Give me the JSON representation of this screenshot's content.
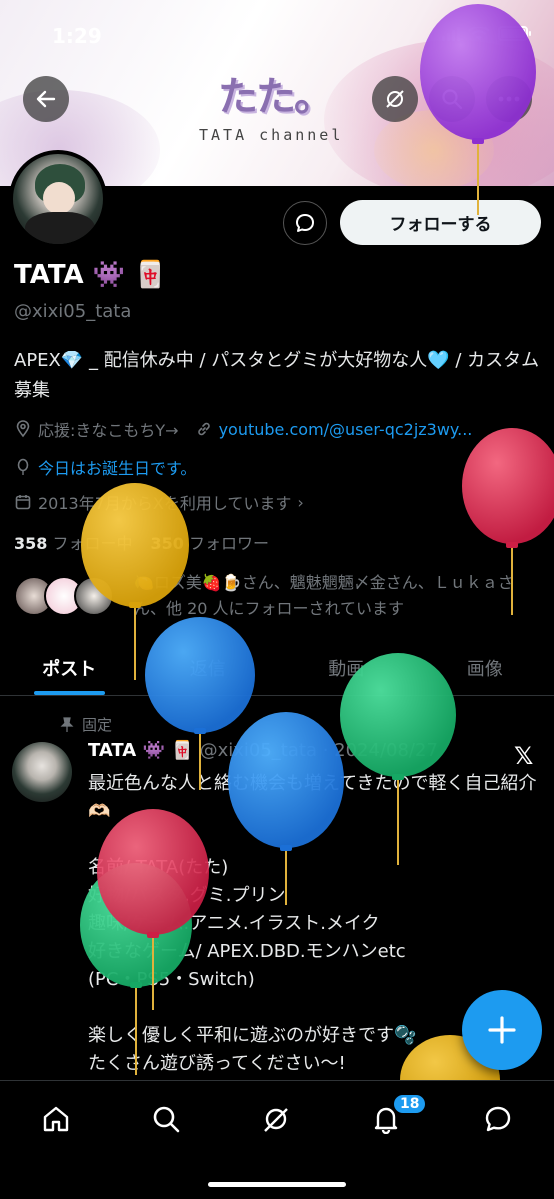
{
  "status_bar": {
    "time": "1:29"
  },
  "banner": {
    "logo_text": "たた。",
    "subtitle": "TATA channel"
  },
  "header": {
    "back_icon": "arrow-left-icon",
    "grok_icon": "grok-icon",
    "search_icon": "search-icon",
    "more_icon": "more-icon"
  },
  "profile": {
    "display_name": "TATA 👾 🀄",
    "handle": "@xixi05_tata",
    "bio": "APEX💎 _ 配信休み中 / パスタとグミが大好物な人🩵 / カスタム募集",
    "support": "応援:きなこもちY→",
    "link": "youtube.com/@user-qc2jz3wy...",
    "birthday": "今日はお誕生日です。",
    "joined": "2013年7月からXを利用しています",
    "following_count": "358",
    "following_label": "フォロー中",
    "followers_count": "350",
    "followers_label": "フォロワー",
    "followed_by": "🍋ロズ美🍓🍺さん、魑魅魍魎〆金さん、Ｌｕｋａさん、他 20 人にフォローされています"
  },
  "actions": {
    "follow_label": "フォローする"
  },
  "tabs": [
    {
      "label": "ポスト"
    },
    {
      "label": "返信"
    },
    {
      "label": "動画"
    },
    {
      "label": "画像"
    }
  ],
  "post": {
    "pinned_label": "固定",
    "name": "TATA 👾 🀄",
    "handle_date": "@xixi05_tata · 2024/08/27",
    "lines": [
      "最近色んな人と絡む機会も増えてきたので軽く自己紹介🫶🏻",
      "",
      "名前/ TATA(たた)",
      "好物/パスタ.グミ.プリン",
      "趣味/ゲーム.アニメ.イラスト.メイク",
      "好きなゲーム/ APEX.DBD.モンハンetc",
      "(PC・PS5・Switch)",
      "",
      "楽しく優しく平和に遊ぶのが好きです🫧",
      "たくさん遊び誘ってください〜!"
    ]
  },
  "nav": {
    "notification_count": "18"
  },
  "colors": {
    "accent": "#1d9bf0",
    "background": "#000000",
    "muted": "#71767b"
  }
}
